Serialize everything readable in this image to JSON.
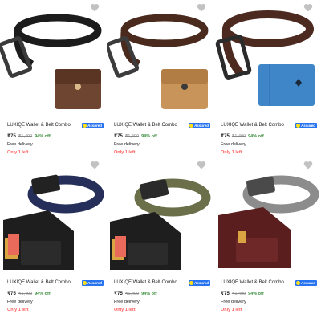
{
  "products": [
    {
      "title": "LUXIQE Wallet & Belt Combo",
      "assured": "Assured",
      "price": "₹75",
      "mrp": "₹1,499",
      "discount": "94% off",
      "delivery": "Free delivery",
      "stock": "Only 1 left",
      "image_icon": "black-belt-brown-wallet-image",
      "belt_color": "#1c1c1c",
      "wallet_color": "#6e4530",
      "buckle_color": "#3a3a3a"
    },
    {
      "title": "LUXIQE Wallet & Belt Combo",
      "assured": "Assured",
      "price": "₹75",
      "mrp": "₹1,499",
      "discount": "94% off",
      "delivery": "Free delivery",
      "stock": "Only 1 left",
      "image_icon": "brown-belt-tan-wallet-image",
      "belt_color": "#4a2a1d",
      "wallet_color": "#c8945a",
      "buckle_color": "#3c3c3c"
    },
    {
      "title": "LUXIQE Wallet & Belt Combo",
      "assured": "Assured",
      "price": "₹75",
      "mrp": "₹1,499",
      "discount": "94% off",
      "delivery": "Free delivery",
      "stock": "Only 1 left",
      "image_icon": "brown-belt-blue-wallet-image",
      "belt_color": "#4d2a20",
      "wallet_color": "#3f86c9",
      "buckle_color": "#2b2b2b"
    },
    {
      "title": "LUXIQE Wallet & Belt Combo",
      "assured": "Assured",
      "price": "₹75",
      "mrp": "₹1,499",
      "discount": "94% off",
      "delivery": "Free delivery",
      "stock": "Only 1 left",
      "image_icon": "navy-belt-black-wallet-image",
      "belt_color": "#262f5a",
      "wallet_color": "#1e1e1e",
      "buckle_color": "#222222"
    },
    {
      "title": "LUXIQE Wallet & Belt Combo",
      "assured": "Assured",
      "price": "₹75",
      "mrp": "₹1,499",
      "discount": "94% off",
      "delivery": "Free delivery",
      "stock": "Only 1 left",
      "image_icon": "olive-belt-black-wallet-image",
      "belt_color": "#6b6f4a",
      "wallet_color": "#1e1e1e",
      "buckle_color": "#2a2a2a"
    },
    {
      "title": "LUXIQE Wallet & Belt Combo",
      "assured": "Assured",
      "price": "₹75",
      "mrp": "₹1,499",
      "discount": "94% off",
      "delivery": "Free delivery",
      "stock": "Only 1 left",
      "image_icon": "grey-belt-maroon-wallet-image",
      "belt_color": "#8c8c8c",
      "wallet_color": "#5a1e1e",
      "buckle_color": "#4a4a4a"
    }
  ],
  "heart_icon": "wishlist-heart-icon",
  "colors": {
    "assured_badge": "#2874f0",
    "discount_green": "#388e3c",
    "stock_red": "#ff6161",
    "heart_grey": "#c2c2c2"
  }
}
